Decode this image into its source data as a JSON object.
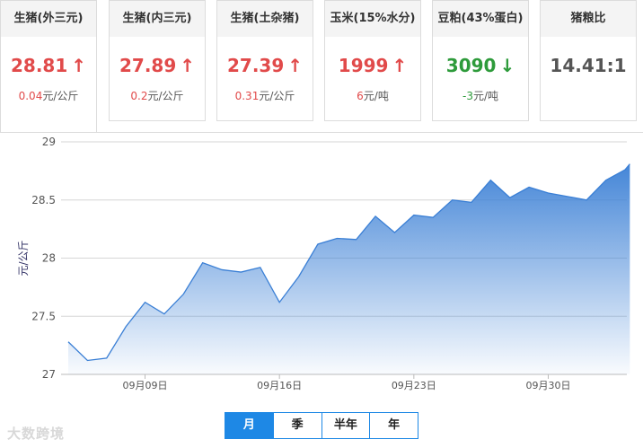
{
  "cards": [
    {
      "title": "生猪(外三元)",
      "price": "28.81",
      "arrow": "↑",
      "trend": "up",
      "change_value": "0.04",
      "change_unit": "元/公斤",
      "active": true
    },
    {
      "title": "生猪(内三元)",
      "price": "27.89",
      "arrow": "↑",
      "trend": "up",
      "change_value": "0.2",
      "change_unit": "元/公斤",
      "active": false
    },
    {
      "title": "生猪(土杂猪)",
      "price": "27.39",
      "arrow": "↑",
      "trend": "up",
      "change_value": "0.31",
      "change_unit": "元/公斤",
      "active": false
    },
    {
      "title": "玉米(15%水分)",
      "price": "1999",
      "arrow": "↑",
      "trend": "up",
      "change_value": "6",
      "change_unit": "元/吨",
      "active": false
    },
    {
      "title": "豆粕(43%蛋白)",
      "price": "3090",
      "arrow": "↓",
      "trend": "down",
      "change_value": "-3",
      "change_unit": "元/吨",
      "active": false
    },
    {
      "title": "猪粮比",
      "price": "14.41:1",
      "arrow": "",
      "trend": "neutral",
      "change_value": "",
      "change_unit": "",
      "active": false
    }
  ],
  "chart_data": {
    "type": "area",
    "ylabel": "元/公斤",
    "ylim": [
      27,
      29
    ],
    "yticks": [
      27,
      27.5,
      28,
      28.5,
      29
    ],
    "xticks": [
      {
        "label": "09月09日",
        "day": 9
      },
      {
        "label": "09月16日",
        "day": 16
      },
      {
        "label": "09月23日",
        "day": 23
      },
      {
        "label": "09月30日",
        "day": 30
      }
    ],
    "line_color": "#3a7fd5",
    "x_days": [
      5,
      6,
      7,
      8,
      9,
      10,
      11,
      12,
      13,
      14,
      15,
      16,
      17,
      18,
      19,
      20,
      21,
      22,
      23,
      24,
      25,
      26,
      27,
      28,
      29,
      30,
      31,
      32,
      33,
      34
    ],
    "values": [
      27.28,
      27.12,
      27.14,
      27.41,
      27.62,
      27.52,
      27.69,
      27.96,
      27.9,
      27.88,
      27.92,
      27.62,
      27.84,
      28.12,
      28.17,
      28.16,
      28.36,
      28.22,
      28.37,
      28.35,
      28.5,
      28.48,
      28.67,
      28.52,
      28.61,
      28.56,
      28.53,
      28.5,
      28.67,
      28.76,
      28.81
    ]
  },
  "range_tabs": [
    "月",
    "季",
    "半年",
    "年"
  ],
  "active_range": "月",
  "watermark": "大数跨境"
}
